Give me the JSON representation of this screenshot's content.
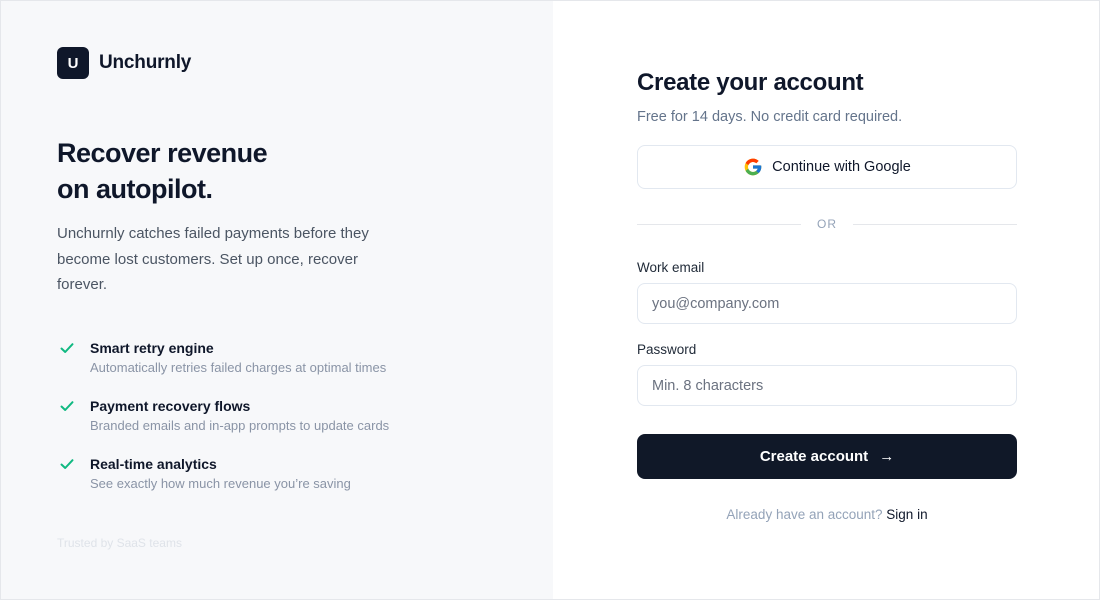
{
  "brand": {
    "logo_letter": "U",
    "name": "Unchurnly"
  },
  "hero": {
    "line1": "Recover revenue",
    "line2": "on autopilot.",
    "description": "Unchurnly catches failed payments before they become lost customers. Set up once, recover forever."
  },
  "features": [
    {
      "title": "Smart retry engine",
      "description": "Automatically retries failed charges at optimal times"
    },
    {
      "title": "Payment recovery flows",
      "description": "Branded emails and in-app prompts to update cards"
    },
    {
      "title": "Real-time analytics",
      "description": "See exactly how much revenue you’re saving"
    }
  ],
  "trusted_text": "Trusted by SaaS teams",
  "form": {
    "title": "Create your account",
    "subtitle": "Free for 14 days. No credit card required.",
    "google_label": "Continue with Google",
    "divider": "OR",
    "email_label": "Work email",
    "email_placeholder": "you@company.com",
    "email_value": "",
    "password_label": "Password",
    "password_placeholder": "Min. 8 characters",
    "password_value": "",
    "submit_label": "Create account",
    "submit_arrow": "→",
    "signin_prompt": "Already have an account?",
    "signin_link": "Sign in"
  },
  "icons": {
    "check": "check-icon",
    "google": "google-icon",
    "arrow": "arrow-right-icon"
  },
  "colors": {
    "brand_dark": "#0f172a",
    "button_dark": "#101828",
    "check_green": "#10b981",
    "left_panel_bg": "#f7f8fa"
  }
}
